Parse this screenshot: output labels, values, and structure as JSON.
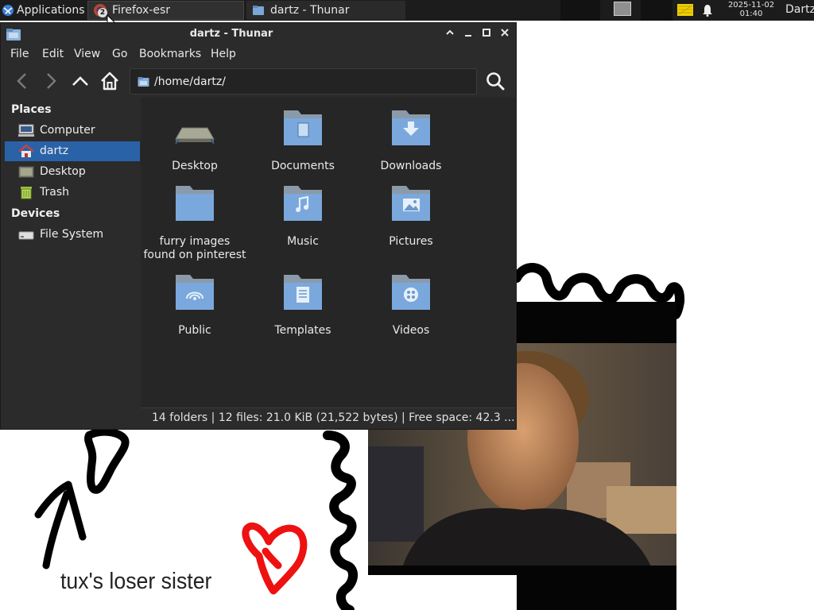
{
  "panel": {
    "applications_label": "Applications",
    "tasks": [
      {
        "label": "Firefox-esr",
        "badge": "2"
      },
      {
        "label": "dartz - Thunar"
      }
    ],
    "clock_date": "2025-11-02",
    "clock_time": "01:40",
    "user": "Dartz"
  },
  "window": {
    "title": "dartz - Thunar",
    "menu": [
      "File",
      "Edit",
      "View",
      "Go",
      "Bookmarks",
      "Help"
    ],
    "location": "/home/dartz/",
    "sidebar": {
      "places_heading": "Places",
      "places": [
        {
          "label": "Computer",
          "icon": "computer-icon"
        },
        {
          "label": "dartz",
          "icon": "home-icon",
          "selected": true
        },
        {
          "label": "Desktop",
          "icon": "desktop-icon"
        },
        {
          "label": "Trash",
          "icon": "trash-icon"
        }
      ],
      "devices_heading": "Devices",
      "devices": [
        {
          "label": "File System",
          "icon": "drive-icon"
        }
      ]
    },
    "files": [
      {
        "name": "Desktop",
        "icon": "desktop-folder-icon"
      },
      {
        "name": "Documents",
        "icon": "documents-folder-icon"
      },
      {
        "name": "Downloads",
        "icon": "downloads-folder-icon"
      },
      {
        "name": "furry images found on pinterest",
        "icon": "folder-icon"
      },
      {
        "name": "Music",
        "icon": "music-folder-icon"
      },
      {
        "name": "Pictures",
        "icon": "pictures-folder-icon"
      },
      {
        "name": "Public",
        "icon": "public-folder-icon"
      },
      {
        "name": "Templates",
        "icon": "templates-folder-icon"
      },
      {
        "name": "Videos",
        "icon": "videos-folder-icon"
      }
    ],
    "status": "14 folders  |  12 files: 21.0 KiB (21,522 bytes)  |  Free space: 42.3 ..."
  },
  "desktop": {
    "caption": "tux's loser sister"
  }
}
